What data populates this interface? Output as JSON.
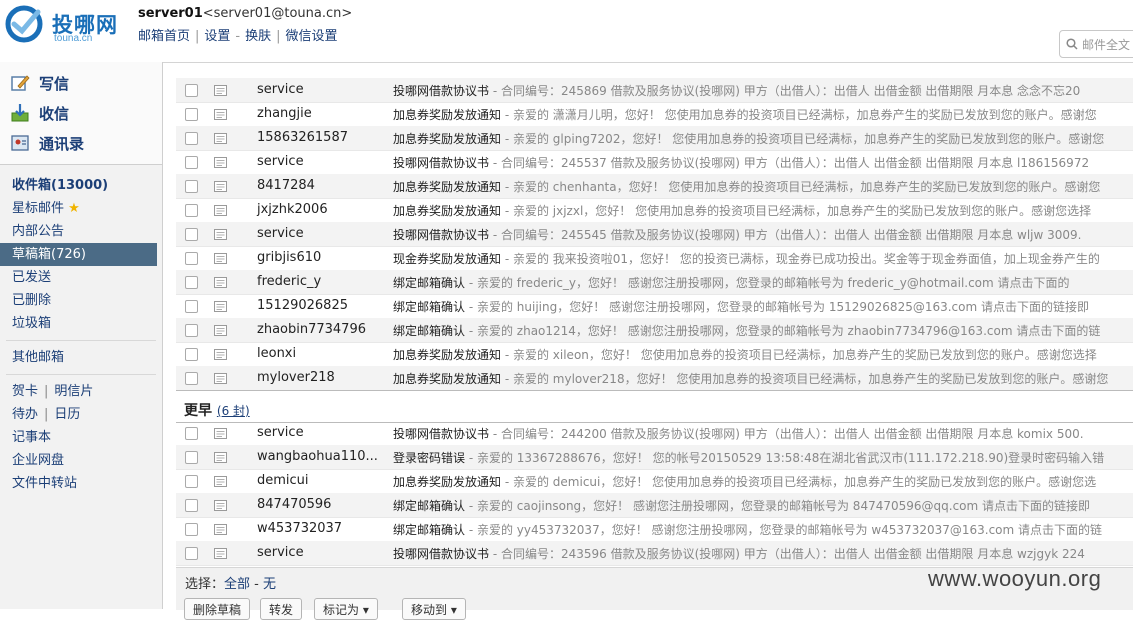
{
  "header": {
    "logo_text": "投哪网",
    "logo_sub": "touna.cn",
    "account_name": "server01",
    "account_email": "<server01@touna.cn>",
    "nav": [
      "邮箱首页",
      "设置",
      "换肤",
      "微信设置"
    ],
    "search_placeholder": "邮件全文"
  },
  "sidebar": {
    "actions": [
      {
        "label": "写信",
        "icon": "compose-icon"
      },
      {
        "label": "收信",
        "icon": "receive-icon"
      },
      {
        "label": "通讯录",
        "icon": "contacts-icon"
      }
    ],
    "folders": [
      {
        "label": "收件箱(13000)",
        "key": "inbox"
      },
      {
        "label": "星标邮件",
        "key": "starred"
      },
      {
        "label": "内部公告",
        "key": "notice"
      },
      {
        "label": "草稿箱(726)",
        "key": "drafts"
      },
      {
        "label": "已发送",
        "key": "sent"
      },
      {
        "label": "已删除",
        "key": "deleted"
      },
      {
        "label": "垃圾箱",
        "key": "junk"
      }
    ],
    "other": "其他邮箱",
    "tools_a": [
      "贺卡",
      "明信片"
    ],
    "tools_b": [
      "待办",
      "日历"
    ],
    "tools": [
      "记事本",
      "企业网盘",
      "文件中转站"
    ]
  },
  "mail": {
    "top_rows": [
      {
        "sender": "service",
        "subject": "投哪网借款协议书",
        "preview": " - 合同编号：245869 借款及服务协议(投哪网) 甲方（出借人）：出借人 出借金额 出借期限 月本息 念念不忘20"
      },
      {
        "sender": "zhangjie",
        "subject": "加息券奖励发放通知",
        "preview": " - 亲爱的 潇潇月儿明，您好！ 您使用加息券的投资项目已经满标，加息券产生的奖励已发放到您的账户。感谢您"
      },
      {
        "sender": "15863261587",
        "subject": "加息券奖励发放通知",
        "preview": " - 亲爱的 glping7202，您好！ 您使用加息券的投资项目已经满标，加息券产生的奖励已发放到您的账户。感谢您"
      },
      {
        "sender": "service",
        "subject": "投哪网借款协议书",
        "preview": " - 合同编号：245537 借款及服务协议(投哪网) 甲方（出借人）：出借人 出借金额 出借期限 月本息 l186156972"
      },
      {
        "sender": "8417284",
        "subject": "加息券奖励发放通知",
        "preview": " - 亲爱的 chenhanta，您好！ 您使用加息券的投资项目已经满标，加息券产生的奖励已发放到您的账户。感谢您"
      },
      {
        "sender": "jxjzhk2006",
        "subject": "加息券奖励发放通知",
        "preview": " - 亲爱的 jxjzxl，您好！ 您使用加息券的投资项目已经满标，加息券产生的奖励已发放到您的账户。感谢您选择"
      },
      {
        "sender": "service",
        "subject": "投哪网借款协议书",
        "preview": " - 合同编号：245545 借款及服务协议(投哪网) 甲方（出借人）：出借人 出借金额 出借期限 月本息 wljw 3009."
      },
      {
        "sender": "gribjis610",
        "subject": "现金券奖励发放通知",
        "preview": " - 亲爱的 我来投资啦01，您好！ 您的投资已满标，现金券已成功投出。奖金等于现金券面值，加上现金券产生的"
      },
      {
        "sender": "frederic_y",
        "subject": "绑定邮箱确认",
        "preview": " - 亲爱的 frederic_y，您好！ 感谢您注册投哪网，您登录的邮箱帐号为 frederic_y@hotmail.com 请点击下面的"
      },
      {
        "sender": "15129026825",
        "subject": "绑定邮箱确认",
        "preview": " - 亲爱的 huijing，您好！ 感谢您注册投哪网，您登录的邮箱帐号为 15129026825@163.com 请点击下面的链接即"
      },
      {
        "sender": "zhaobin7734796",
        "subject": "绑定邮箱确认",
        "preview": " - 亲爱的 zhao1214，您好！ 感谢您注册投哪网，您登录的邮箱帐号为 zhaobin7734796@163.com 请点击下面的链"
      },
      {
        "sender": "leonxi",
        "subject": "加息券奖励发放通知",
        "preview": " - 亲爱的 xileon，您好！ 您使用加息券的投资项目已经满标，加息券产生的奖励已发放到您的账户。感谢您选择"
      },
      {
        "sender": "mylover218",
        "subject": "加息券奖励发放通知",
        "preview": " - 亲爱的 mylover218，您好！ 您使用加息券的投资项目已经满标，加息券产生的奖励已发放到您的账户。感谢您"
      }
    ],
    "group_label": "更早",
    "group_count": "6 封",
    "earlier_rows": [
      {
        "sender": "service",
        "subject": "投哪网借款协议书",
        "preview": " - 合同编号：244200 借款及服务协议(投哪网) 甲方（出借人）：出借人 出借金额 出借期限 月本息 komix 500."
      },
      {
        "sender": "wangbaohua110...",
        "subject": "登录密码错误",
        "preview": " - 亲爱的 13367288676，您好！ 您的帐号20150529 13:58:48在湖北省武汉市(111.172.218.90)登录时密码输入错"
      },
      {
        "sender": "demicui",
        "subject": "加息券奖励发放通知",
        "preview": " - 亲爱的 demicui，您好！ 您使用加息券的投资项目已经满标，加息券产生的奖励已发放到您的账户。感谢您选"
      },
      {
        "sender": "847470596",
        "subject": "绑定邮箱确认",
        "preview": " - 亲爱的 caojinsong，您好！ 感谢您注册投哪网，您登录的邮箱帐号为 847470596@qq.com 请点击下面的链接即"
      },
      {
        "sender": "w453732037",
        "subject": "绑定邮箱确认",
        "preview": " - 亲爱的 yy453732037，您好！ 感谢您注册投哪网，您登录的邮箱帐号为 w453732037@163.com 请点击下面的链"
      },
      {
        "sender": "service",
        "subject": "投哪网借款协议书",
        "preview": " - 合同编号：243596 借款及服务协议(投哪网) 甲方（出借人）：出借人 出借金额 出借期限 月本息 wzjgyk 224"
      }
    ],
    "select_label": "选择：",
    "select_all": "全部",
    "select_none": "无",
    "buttons": [
      "删除草稿",
      "转发",
      "标记为",
      "移动到"
    ]
  },
  "watermark": "www.wooyun.org",
  "colors": {
    "brand": "#1a6fb8",
    "active_folder": "#4b6b86",
    "link": "#1c3f77"
  }
}
